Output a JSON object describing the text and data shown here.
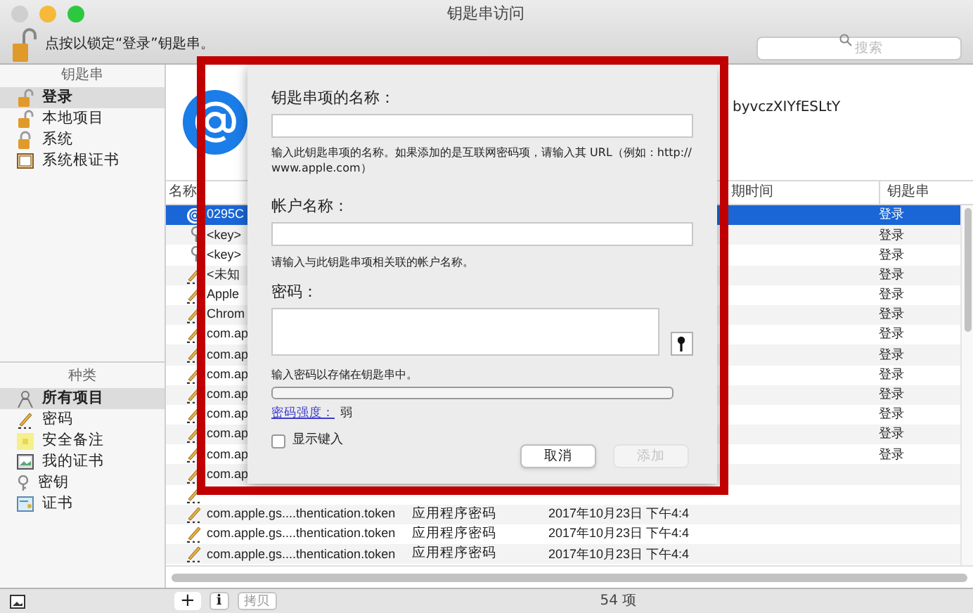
{
  "window": {
    "title": "钥匙串访问"
  },
  "toolbar": {
    "lock_text": "点按以锁定“登录”钥匙串。",
    "search": {
      "placeholder": "搜索"
    }
  },
  "sidebar": {
    "keychains_header": "钥匙串",
    "keychains": [
      {
        "label": "登录",
        "kind": "unlocked",
        "selected": true
      },
      {
        "label": "本地项目",
        "kind": "unlocked",
        "selected": false
      },
      {
        "label": "系统",
        "kind": "locked",
        "selected": false
      },
      {
        "label": "系统根证书",
        "kind": "cabinet",
        "selected": false
      }
    ],
    "categories_header": "种类",
    "categories": [
      {
        "label": "所有项目",
        "kind": "all",
        "selected": true
      },
      {
        "label": "密码",
        "kind": "password",
        "selected": false
      },
      {
        "label": "安全备注",
        "kind": "note",
        "selected": false
      },
      {
        "label": "我的证书",
        "kind": "mycert",
        "selected": false
      },
      {
        "label": "密钥",
        "kind": "key",
        "selected": false
      },
      {
        "label": "证书",
        "kind": "cert",
        "selected": false
      }
    ]
  },
  "detail": {
    "text": "byvczXIYfESLtY"
  },
  "table": {
    "columns": [
      {
        "label": "名称"
      },
      {
        "label": "期时间"
      },
      {
        "label": "钥匙串"
      }
    ],
    "rows": [
      {
        "name": "0295C",
        "kind": "internet",
        "keychain": "登录",
        "selected": true
      },
      {
        "name": "<key>",
        "kind": "key",
        "keychain": "登录",
        "selected": false
      },
      {
        "name": "<key>",
        "kind": "key",
        "keychain": "登录",
        "selected": false
      },
      {
        "name": "<未知",
        "kind": "password",
        "keychain": "登录",
        "selected": false
      },
      {
        "name": "Apple",
        "kind": "password",
        "keychain": "登录",
        "selected": false
      },
      {
        "name": "Chrom",
        "kind": "password",
        "keychain": "登录",
        "selected": false
      },
      {
        "name": "com.ap",
        "kind": "password",
        "keychain": "登录",
        "selected": false
      },
      {
        "name": "com.ap",
        "kind": "password",
        "keychain": "登录",
        "selected": false
      },
      {
        "name": "com.ap",
        "kind": "password",
        "keychain": "登录",
        "selected": false
      },
      {
        "name": "com.ap",
        "kind": "password",
        "keychain": "登录",
        "selected": false
      },
      {
        "name": "com.ap",
        "kind": "password",
        "keychain": "登录",
        "selected": false
      },
      {
        "name": "com.ap",
        "kind": "password",
        "keychain": "登录",
        "selected": false
      },
      {
        "name": "com.ap",
        "kind": "password",
        "keychain": "登录",
        "selected": false
      },
      {
        "name": "com.ap",
        "kind": "password",
        "selected": false
      },
      {
        "kind": "password",
        "selected": false
      },
      {
        "name": "com.apple.gs....thentication.token",
        "type": "应用程序密码",
        "date": "2017年10月23日 下午4:4",
        "kind": "password",
        "selected": false
      },
      {
        "name": "com.apple.gs....thentication.token",
        "type": "应用程序密码",
        "date": "2017年10月23日 下午4:4",
        "kind": "password",
        "selected": false
      },
      {
        "name": "com.apple.gs....thentication.token",
        "type": "应用程序密码",
        "date": "2017年10月23日 下午4:4",
        "kind": "password",
        "selected": false
      }
    ]
  },
  "dialog": {
    "name_label": "钥匙串项的名称：",
    "name_help": "输入此钥匙串项的名称。如果添加的是互联网密码项，请输入其 URL（例如：http://www.apple.com）",
    "account_label": "帐户名称：",
    "account_help": "请输入与此钥匙串项相关联的帐户名称。",
    "password_label": "密码：",
    "password_help": "输入密码以存储在钥匙串中。",
    "strength": {
      "level": 0,
      "link": "密码强度：",
      "value": "弱"
    },
    "show_typing": {
      "label": "显示键入",
      "checked": false
    },
    "buttons": [
      {
        "label": "取消",
        "disabled": false
      },
      {
        "label": "添加",
        "disabled": true
      }
    ]
  },
  "status_bar": {
    "buttons": [
      {
        "kind": "plus",
        "label": "+"
      },
      {
        "kind": "info",
        "label": "i"
      },
      {
        "kind": "copy",
        "label": "拷贝"
      }
    ],
    "count": "54 项"
  }
}
